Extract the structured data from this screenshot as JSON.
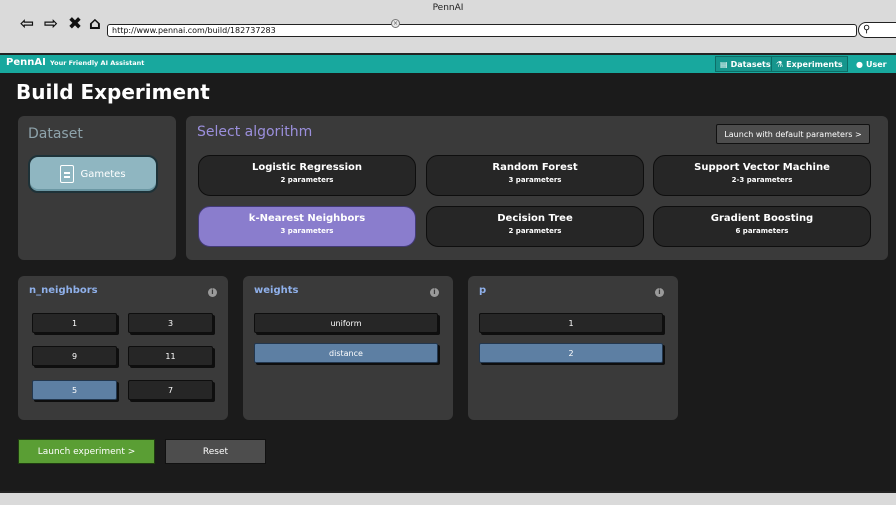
{
  "browser": {
    "window_title": "PennAI",
    "url": "http://www.pennai.com/build/182737283",
    "nav_icons": [
      "back-arrow-icon",
      "forward-arrow-icon",
      "close-icon",
      "home-icon"
    ]
  },
  "header": {
    "brand": "PennAI",
    "tagline": "Your Friendly AI Assistant",
    "accent_color": "#18a89e",
    "nav": [
      {
        "label": "Datasets",
        "icon": "document-icon"
      },
      {
        "label": "Experiments",
        "icon": "flask-icon"
      },
      {
        "label": "User",
        "icon": "user-icon"
      }
    ]
  },
  "page": {
    "title": "Build Experiment"
  },
  "dataset_panel": {
    "title": "Dataset",
    "dataset_name": "Gametes"
  },
  "algorithm_panel": {
    "title": "Select algorithm",
    "launch_default_label": "Launch with default parameters >",
    "selected_color": "#8a7dcd",
    "algorithms": [
      {
        "name": "Logistic Regression",
        "params": "2 parameters",
        "selected": false
      },
      {
        "name": "Random Forest",
        "params": "3 parameters",
        "selected": false
      },
      {
        "name": "Support Vector Machine",
        "params": "2-3 parameters",
        "selected": false
      },
      {
        "name": "k-Nearest Neighbors",
        "params": "3 parameters",
        "selected": true
      },
      {
        "name": "Decision Tree",
        "params": "2 parameters",
        "selected": false
      },
      {
        "name": "Gradient Boosting",
        "params": "6 parameters",
        "selected": false
      }
    ]
  },
  "parameters": {
    "selected_color": "#5d7fa3",
    "n_neighbors": {
      "title": "n_neighbors",
      "options": [
        "1",
        "3",
        "9",
        "11",
        "5",
        "7"
      ],
      "selected": "5"
    },
    "weights": {
      "title": "weights",
      "options": [
        "uniform",
        "distance"
      ],
      "selected": "distance"
    },
    "p": {
      "title": "p",
      "options": [
        "1",
        "2"
      ],
      "selected": "2"
    },
    "info_icon": "info-icon"
  },
  "actions": {
    "launch_label": "Launch experiment >",
    "reset_label": "Reset"
  }
}
